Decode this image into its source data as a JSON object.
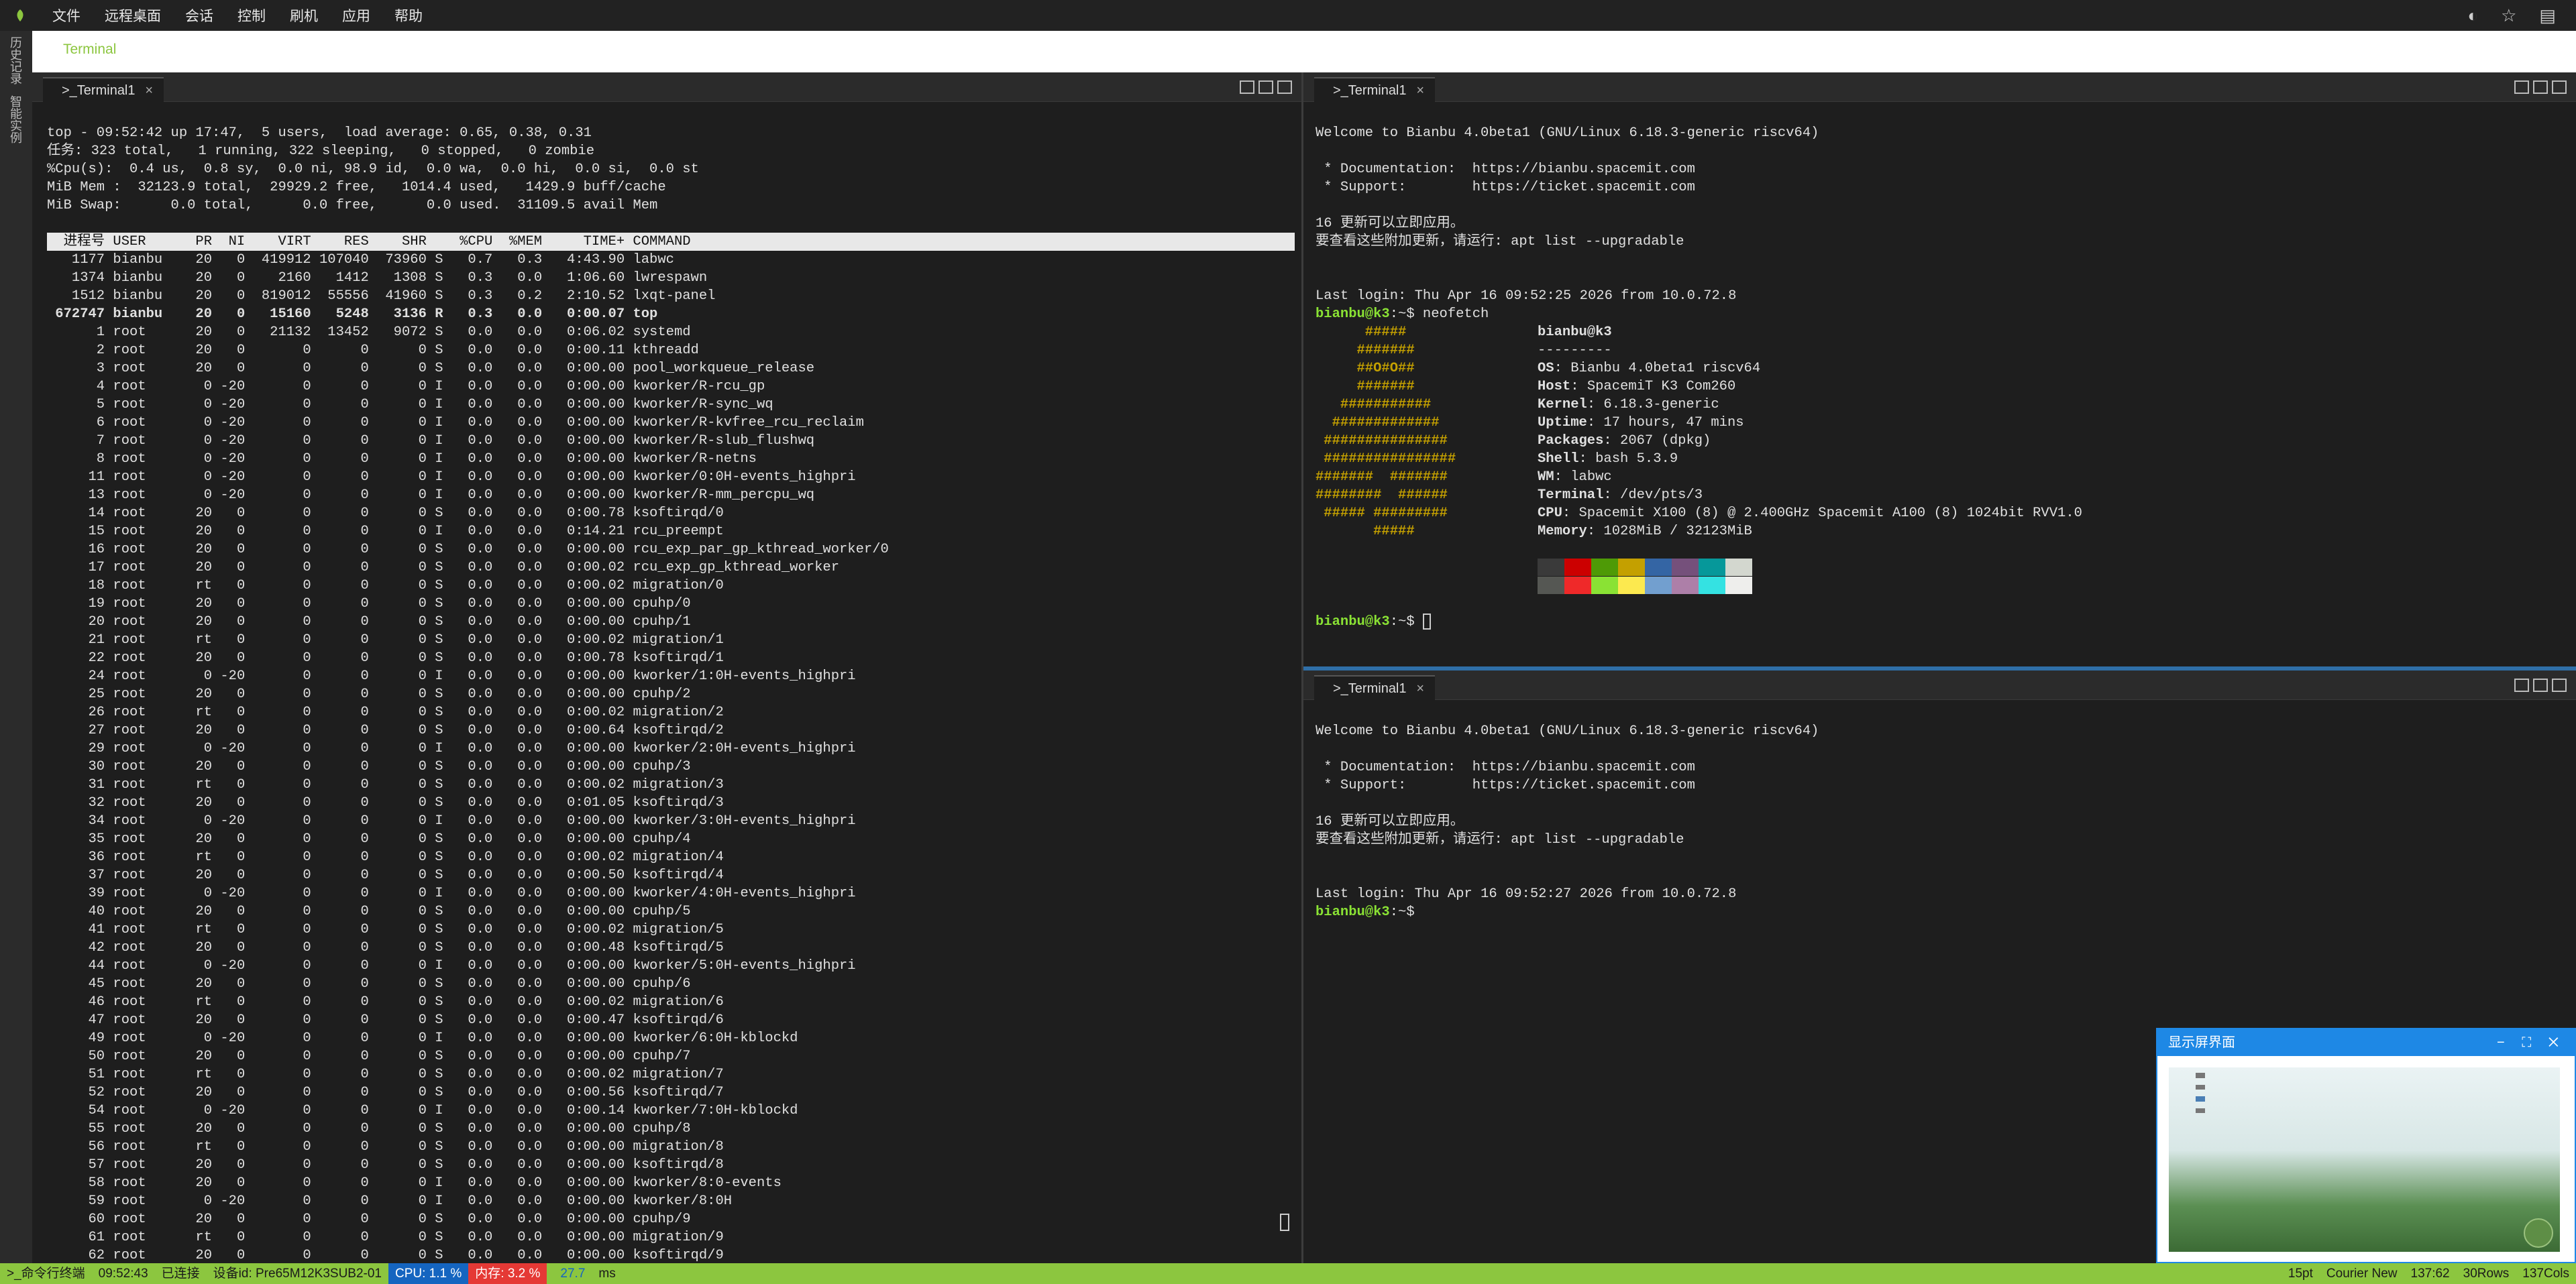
{
  "menubar": {
    "items": [
      "文件",
      "远程桌面",
      "会话",
      "控制",
      "刷机",
      "应用",
      "帮助"
    ],
    "icons": [
      "palette-icon",
      "star-icon",
      "note-icon"
    ]
  },
  "leftrail": {
    "items": [
      "历史记录",
      "智能实例"
    ]
  },
  "apptab": {
    "label": "Terminal"
  },
  "left": {
    "tab_label": ">_Terminal1",
    "close": "×",
    "top_lines": [
      "top - 09:52:42 up 17:47,  5 users,  load average: 0.65, 0.38, 0.31",
      "任务: 323 total,   1 running, 322 sleeping,   0 stopped,   0 zombie",
      "%Cpu(s):  0.4 us,  0.8 sy,  0.0 ni, 98.9 id,  0.0 wa,  0.0 hi,  0.0 si,  0.0 st",
      "MiB Mem :  32123.9 total,  29929.2 free,   1014.4 used,   1429.9 buff/cache",
      "MiB Swap:      0.0 total,      0.0 free,      0.0 used.  31109.5 avail Mem"
    ],
    "header": "  进程号 USER      PR  NI    VIRT    RES    SHR    %CPU  %MEM     TIME+ COMMAND                                                      ",
    "rows": [
      "   1177 bianbu    20   0  419912 107040  73960 S   0.7   0.3   4:43.90 labwc",
      "   1374 bianbu    20   0    2160   1412   1308 S   0.3   0.0   1:06.60 lwrespawn",
      "   1512 bianbu    20   0  819012  55556  41960 S   0.3   0.2   2:10.52 lxqt-panel",
      " 672747 bianbu    20   0   15160   5248   3136 R   0.3   0.0   0:00.07 top",
      "      1 root      20   0   21132  13452   9072 S   0.0   0.0   0:06.02 systemd",
      "      2 root      20   0       0      0      0 S   0.0   0.0   0:00.11 kthreadd",
      "      3 root      20   0       0      0      0 S   0.0   0.0   0:00.00 pool_workqueue_release",
      "      4 root       0 -20       0      0      0 I   0.0   0.0   0:00.00 kworker/R-rcu_gp",
      "      5 root       0 -20       0      0      0 I   0.0   0.0   0:00.00 kworker/R-sync_wq",
      "      6 root       0 -20       0      0      0 I   0.0   0.0   0:00.00 kworker/R-kvfree_rcu_reclaim",
      "      7 root       0 -20       0      0      0 I   0.0   0.0   0:00.00 kworker/R-slub_flushwq",
      "      8 root       0 -20       0      0      0 I   0.0   0.0   0:00.00 kworker/R-netns",
      "     11 root       0 -20       0      0      0 I   0.0   0.0   0:00.00 kworker/0:0H-events_highpri",
      "     13 root       0 -20       0      0      0 I   0.0   0.0   0:00.00 kworker/R-mm_percpu_wq",
      "     14 root      20   0       0      0      0 S   0.0   0.0   0:00.78 ksoftirqd/0",
      "     15 root      20   0       0      0      0 I   0.0   0.0   0:14.21 rcu_preempt",
      "     16 root      20   0       0      0      0 S   0.0   0.0   0:00.00 rcu_exp_par_gp_kthread_worker/0",
      "     17 root      20   0       0      0      0 S   0.0   0.0   0:00.02 rcu_exp_gp_kthread_worker",
      "     18 root      rt   0       0      0      0 S   0.0   0.0   0:00.02 migration/0",
      "     19 root      20   0       0      0      0 S   0.0   0.0   0:00.00 cpuhp/0",
      "     20 root      20   0       0      0      0 S   0.0   0.0   0:00.00 cpuhp/1",
      "     21 root      rt   0       0      0      0 S   0.0   0.0   0:00.02 migration/1",
      "     22 root      20   0       0      0      0 S   0.0   0.0   0:00.78 ksoftirqd/1",
      "     24 root       0 -20       0      0      0 I   0.0   0.0   0:00.00 kworker/1:0H-events_highpri",
      "     25 root      20   0       0      0      0 S   0.0   0.0   0:00.00 cpuhp/2",
      "     26 root      rt   0       0      0      0 S   0.0   0.0   0:00.02 migration/2",
      "     27 root      20   0       0      0      0 S   0.0   0.0   0:00.64 ksoftirqd/2",
      "     29 root       0 -20       0      0      0 I   0.0   0.0   0:00.00 kworker/2:0H-events_highpri",
      "     30 root      20   0       0      0      0 S   0.0   0.0   0:00.00 cpuhp/3",
      "     31 root      rt   0       0      0      0 S   0.0   0.0   0:00.02 migration/3",
      "     32 root      20   0       0      0      0 S   0.0   0.0   0:01.05 ksoftirqd/3",
      "     34 root       0 -20       0      0      0 I   0.0   0.0   0:00.00 kworker/3:0H-events_highpri",
      "     35 root      20   0       0      0      0 S   0.0   0.0   0:00.00 cpuhp/4",
      "     36 root      rt   0       0      0      0 S   0.0   0.0   0:00.02 migration/4",
      "     37 root      20   0       0      0      0 S   0.0   0.0   0:00.50 ksoftirqd/4",
      "     39 root       0 -20       0      0      0 I   0.0   0.0   0:00.00 kworker/4:0H-events_highpri",
      "     40 root      20   0       0      0      0 S   0.0   0.0   0:00.00 cpuhp/5",
      "     41 root      rt   0       0      0      0 S   0.0   0.0   0:00.02 migration/5",
      "     42 root      20   0       0      0      0 S   0.0   0.0   0:00.48 ksoftirqd/5",
      "     44 root       0 -20       0      0      0 I   0.0   0.0   0:00.00 kworker/5:0H-events_highpri",
      "     45 root      20   0       0      0      0 S   0.0   0.0   0:00.00 cpuhp/6",
      "     46 root      rt   0       0      0      0 S   0.0   0.0   0:00.02 migration/6",
      "     47 root      20   0       0      0      0 S   0.0   0.0   0:00.47 ksoftirqd/6",
      "     49 root       0 -20       0      0      0 I   0.0   0.0   0:00.00 kworker/6:0H-kblockd",
      "     50 root      20   0       0      0      0 S   0.0   0.0   0:00.00 cpuhp/7",
      "     51 root      rt   0       0      0      0 S   0.0   0.0   0:00.02 migration/7",
      "     52 root      20   0       0      0      0 S   0.0   0.0   0:00.56 ksoftirqd/7",
      "     54 root       0 -20       0      0      0 I   0.0   0.0   0:00.14 kworker/7:0H-kblockd",
      "     55 root      20   0       0      0      0 S   0.0   0.0   0:00.00 cpuhp/8",
      "     56 root      rt   0       0      0      0 S   0.0   0.0   0:00.00 migration/8",
      "     57 root      20   0       0      0      0 S   0.0   0.0   0:00.00 ksoftirqd/8",
      "     58 root      20   0       0      0      0 I   0.0   0.0   0:00.00 kworker/8:0-events",
      "     59 root       0 -20       0      0      0 I   0.0   0.0   0:00.00 kworker/8:0H",
      "     60 root      20   0       0      0      0 S   0.0   0.0   0:00.00 cpuhp/9",
      "     61 root      rt   0       0      0      0 S   0.0   0.0   0:00.00 migration/9",
      "     62 root      20   0       0      0      0 S   0.0   0.0   0:00.00 ksoftirqd/9"
    ]
  },
  "rtop": {
    "tab_label": ">_Terminal1",
    "close": "×",
    "welcome": "Welcome to Bianbu 4.0beta1 (GNU/Linux 6.18.3-generic riscv64)",
    "doc": " * Documentation:  https://bianbu.spacemit.com",
    "support": " * Support:        https://ticket.spacemit.com",
    "upd1": "16 更新可以立即应用。",
    "upd2": "要查看这些附加更新，请运行: apt list --upgradable",
    "lastlogin": "Last login: Thu Apr 16 09:52:25 2026 from 10.0.72.8",
    "prompt": "bianbu@k3",
    "prompt_tail": ":~$ neofetch",
    "nf_user": "bianbu@k3",
    "nf_sep": "---------",
    "nf_lines": [
      {
        "k": "OS",
        "v": ": Bianbu 4.0beta1 riscv64"
      },
      {
        "k": "Host",
        "v": ": SpacemiT K3 Com260"
      },
      {
        "k": "Kernel",
        "v": ": 6.18.3-generic"
      },
      {
        "k": "Uptime",
        "v": ": 17 hours, 47 mins"
      },
      {
        "k": "Packages",
        "v": ": 2067 (dpkg)"
      },
      {
        "k": "Shell",
        "v": ": bash 5.3.9"
      },
      {
        "k": "WM",
        "v": ": labwc"
      },
      {
        "k": "Terminal",
        "v": ": /dev/pts/3"
      },
      {
        "k": "CPU",
        "v": ": Spacemit X100 (8) @ 2.400GHz Spacemit A100 (8) 1024bit RVV1.0"
      },
      {
        "k": "Memory",
        "v": ": 1028MiB / 32123MiB"
      }
    ],
    "ascii": [
      "      #####",
      "     #######",
      "     ##O#O##",
      "     #######",
      "   ###########",
      "  #############",
      " ###############",
      " ################",
      "#######  #######",
      "########  ######",
      " ##### #########",
      "       #####"
    ],
    "palette_top": [
      "#3a3a3a",
      "#cc0000",
      "#4e9a06",
      "#c4a000",
      "#3465a4",
      "#75507b",
      "#06989a",
      "#d3d7cf"
    ],
    "palette_bot": [
      "#555753",
      "#ef2929",
      "#8ae234",
      "#fce94f",
      "#729fcf",
      "#ad7fa8",
      "#34e2e2",
      "#eeeeec"
    ],
    "prompt2": "bianbu@k3",
    "prompt2_tail": ":~$ "
  },
  "rbot": {
    "tab_label": ">_Terminal1",
    "close": "×",
    "welcome": "Welcome to Bianbu 4.0beta1 (GNU/Linux 6.18.3-generic riscv64)",
    "doc": " * Documentation:  https://bianbu.spacemit.com",
    "support": " * Support:        https://ticket.spacemit.com",
    "upd1": "16 更新可以立即应用。",
    "upd2": "要查看这些附加更新，请运行: apt list --upgradable",
    "lastlogin": "Last login: Thu Apr 16 09:52:27 2026 from 10.0.72.8",
    "prompt": "bianbu@k3",
    "prompt_tail": ":~$"
  },
  "preview": {
    "title": "显示屏界面",
    "controls": "− ⛶ ✕"
  },
  "status": {
    "cmd": ">_命令行终端",
    "time": "09:52:43",
    "conn": "已连接",
    "device": "设备id: Pre65M12K3SUB2-01",
    "cpu": "CPU: 1.1 %",
    "mem": "内存: 3.2 %",
    "lat_val": "27.7",
    "lat_unit": "ms",
    "font_size": "15pt",
    "font": "Courier New",
    "pos": "137:62",
    "rows": "30Rows",
    "cols": "137Cols"
  },
  "colors": {
    "accent": "#8cc63f",
    "prompt": "#8ae234",
    "cpu_badge": "#1565c0",
    "mem_badge": "#e53935"
  }
}
